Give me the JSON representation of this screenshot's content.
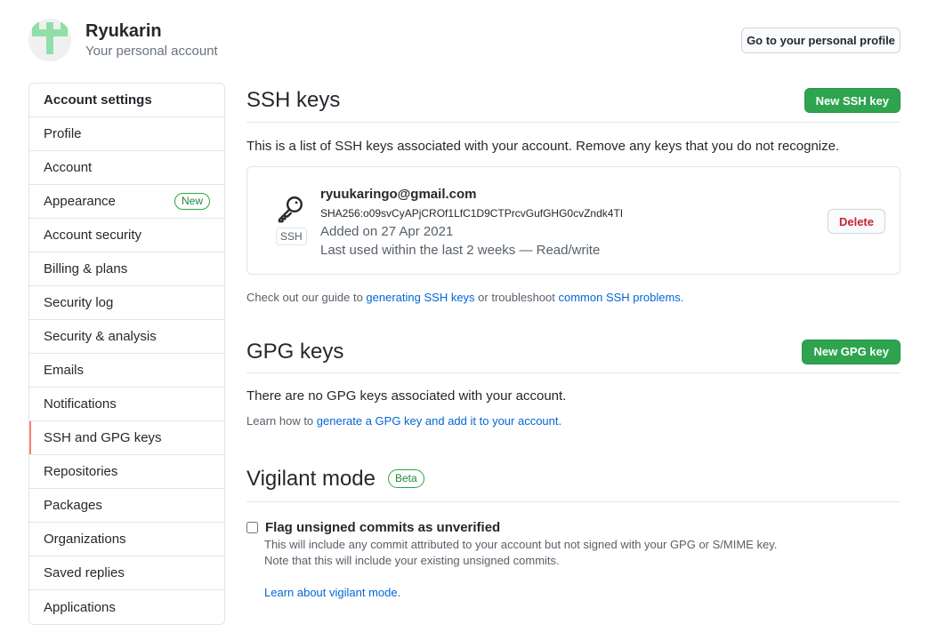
{
  "header": {
    "user_name": "Ryukarin",
    "subtitle": "Your personal account",
    "profile_button": "Go to your personal profile"
  },
  "sidebar": {
    "heading": "Account settings",
    "items": [
      {
        "label": "Profile"
      },
      {
        "label": "Account"
      },
      {
        "label": "Appearance",
        "badge": "New"
      },
      {
        "label": "Account security"
      },
      {
        "label": "Billing & plans"
      },
      {
        "label": "Security log"
      },
      {
        "label": "Security & analysis"
      },
      {
        "label": "Emails"
      },
      {
        "label": "Notifications"
      },
      {
        "label": "SSH and GPG keys",
        "selected": true
      },
      {
        "label": "Repositories"
      },
      {
        "label": "Packages"
      },
      {
        "label": "Organizations"
      },
      {
        "label": "Saved replies"
      },
      {
        "label": "Applications"
      }
    ]
  },
  "ssh": {
    "title": "SSH keys",
    "new_button": "New SSH key",
    "description": "This is a list of SSH keys associated with your account. Remove any keys that you do not recognize.",
    "key": {
      "type_label": "SSH",
      "title": "ryuukaringo@gmail.com",
      "fingerprint": "SHA256:o09svCyAPjCROf1LfC1D9CTPrcvGufGHG0cvZndk4TI",
      "added": "Added on 27 Apr 2021",
      "last_used": "Last used within the last 2 weeks — Read/write",
      "delete_button": "Delete"
    },
    "guide_prefix": "Check out our guide to ",
    "guide_link1": "generating SSH keys",
    "guide_middle": " or troubleshoot ",
    "guide_link2": "common SSH problems."
  },
  "gpg": {
    "title": "GPG keys",
    "new_button": "New GPG key",
    "empty_text": "There are no GPG keys associated with your account.",
    "learn_prefix": "Learn how to ",
    "learn_link": "generate a GPG key and add it to your account."
  },
  "vigilant": {
    "title": "Vigilant mode",
    "badge": "Beta",
    "checkbox_label": "Flag unsigned commits as unverified",
    "checked": false,
    "desc_line1": "This will include any commit attributed to your account but not signed with your GPG or S/MIME key.",
    "desc_line2": "Note that this will include your existing unsigned commits.",
    "learn_link": "Learn about vigilant mode."
  },
  "colors": {
    "accent_green": "#2ea44f",
    "selected_indicator": "#f9826c",
    "link": "#0366d6",
    "danger": "#cb2431"
  }
}
